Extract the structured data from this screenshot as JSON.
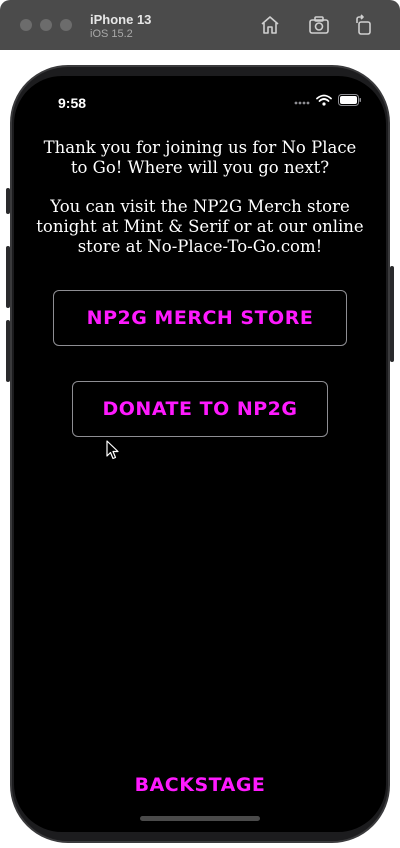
{
  "simulator": {
    "device_name": "iPhone 13",
    "os_version": "iOS 15.2",
    "toolbar_icons": [
      "home-icon",
      "screenshot-icon",
      "rotate-icon"
    ]
  },
  "status_bar": {
    "time": "9:58",
    "icons": [
      "signal-dots-icon",
      "wifi-icon",
      "battery-icon"
    ]
  },
  "content": {
    "paragraph_1": "Thank you for joining us for No Place to Go! Where will you go next?",
    "paragraph_2": "You can visit the NP2G Merch store tonight at Mint & Serif or at our online store at No-Place-To-Go.com!",
    "merch_button_label": "NP2G MERCH STORE",
    "donate_button_label": "DONATE TO NP2G",
    "backstage_label": "BACKSTAGE"
  },
  "colors": {
    "background": "#000000",
    "text": "#ffffff",
    "accent": "#ff1aff",
    "button_border": "#8e8e93",
    "toolbar": "#4b4b4b"
  }
}
